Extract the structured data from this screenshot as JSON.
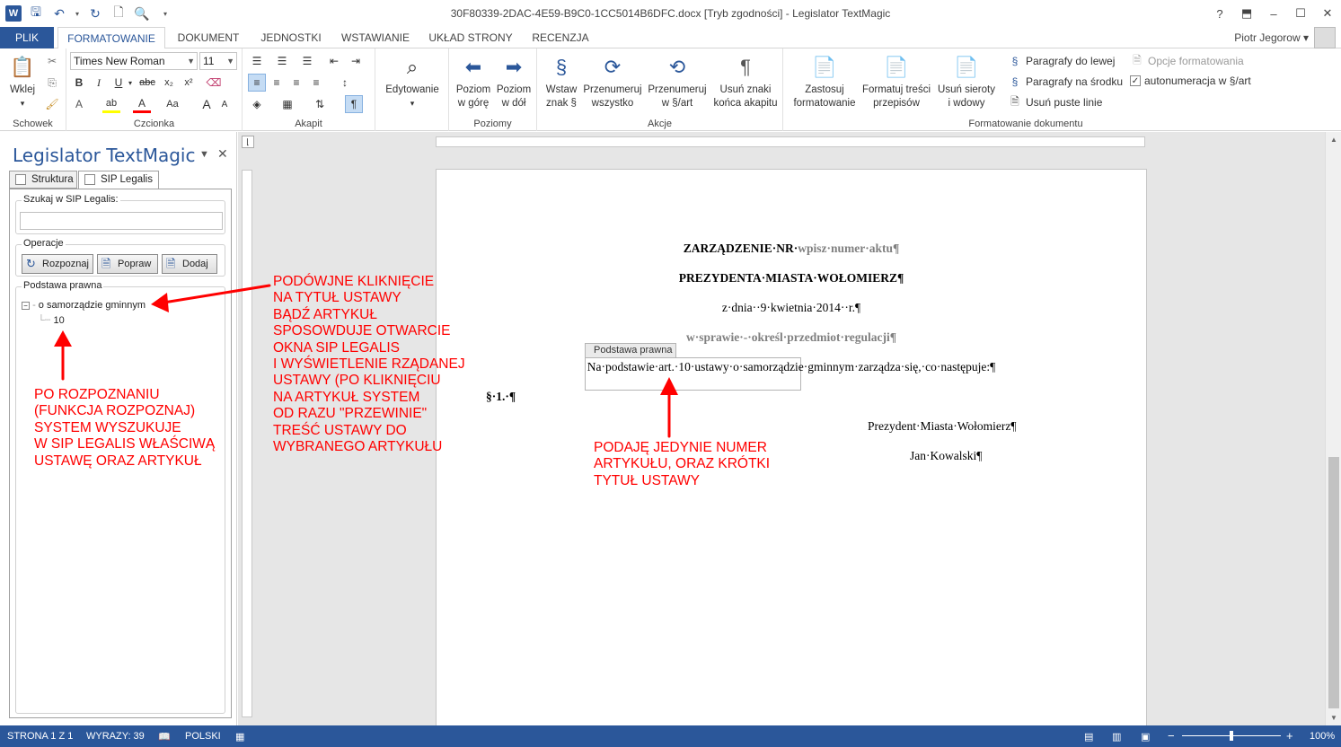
{
  "window": {
    "title": "30F80339-2DAC-4E59-B9C0-1CC5014B6DFC.docx [Tryb zgodności] - Legislator TextMagic",
    "help": "?",
    "minimize": "–",
    "restore": "☐",
    "close": "✕"
  },
  "tabs": [
    "PLIK",
    "FORMATOWANIE",
    "DOKUMENT",
    "JEDNOSTKI",
    "WSTAWIANIE",
    "UKŁAD STRONY",
    "RECENZJA"
  ],
  "user": "Piotr Jegorow",
  "ribbon": {
    "clipboard": {
      "paste": "Wklej",
      "label": "Schowek"
    },
    "font": {
      "name": "Times New Roman",
      "size": "11",
      "label": "Czcionka"
    },
    "paragraph": {
      "label": "Akapit"
    },
    "editing": {
      "label": "Edytowanie"
    },
    "levels": {
      "up_line1": "Poziom",
      "up_line2": "w górę",
      "down_line1": "Poziom",
      "down_line2": "w dół",
      "label": "Poziomy"
    },
    "actions": {
      "insert_line1": "Wstaw",
      "insert_line2": "znak §",
      "renumber_all_line1": "Przenumeruj",
      "renumber_all_line2": "wszystko",
      "renumber_art_line1": "Przenumeruj",
      "renumber_art_line2": "w §/art",
      "remove_line1": "Usuń znaki",
      "remove_line2": "końca akapitu",
      "label": "Akcje"
    },
    "doc_format": {
      "apply_line1": "Zastosuj",
      "apply_line2": "formatowanie",
      "format_line1": "Formatuj treści",
      "format_line2": "przepisów",
      "orphans_line1": "Usuń sieroty",
      "orphans_line2": "i wdowy",
      "para_left": "Paragrafy do lewej",
      "para_center": "Paragrafy na środku",
      "remove_empty": "Usuń puste linie",
      "options": "Opcje formatowania",
      "autonum": "autonumeracja w §/art",
      "label": "Formatowanie dokumentu"
    }
  },
  "pane": {
    "title": "Legislator TextMagic",
    "tab_struct": "Struktura",
    "tab_sip": "SIP Legalis",
    "search_legend": "Szukaj w SIP Legalis:",
    "ops_legend": "Operacje",
    "btn_recognize": "Rozpoznaj",
    "btn_fix": "Popraw",
    "btn_add": "Dodaj",
    "basis_legend": "Podstawa prawna",
    "tree_root": "o samorządzie gminnym",
    "tree_child": "10"
  },
  "annotations": {
    "left": "PO ROZPOZNANIU\n(FUNKCJA ROZPOZNAJ)\nSYSTEM WYSZUKUJE\nW SIP LEGALIS WŁAŚCIWĄ\nUSTAWĘ ORAZ ARTYKUŁ",
    "middle": "PODÓWJNE KLIKNIĘCIE\nNA TYTUŁ USTAWY\nBĄDŹ ARTYKUŁ\nSPOSOWDUJE OTWARCIE\nOKNA SIP LEGALIS\nI WYŚWIETLENIE RZĄDANEJ\nUSTAWY (PO KLIKNIĘCIU\nNA ARTYKUŁ SYSTEM\nOD RAZU \"PRZEWINIE\"\nTREŚĆ USTAWY DO\nWYBRANEGO ARTYKUŁU",
    "right": "PODAJĘ JEDYNIE NUMER\nARTYKUŁU, ORAZ KRÓTKI\nTYTUŁ USTAWY",
    "arrow_color": "#ff0000"
  },
  "document": {
    "line1_prefix": "ZARZĄDZENIE·NR·",
    "line1_placeholder": "wpisz·numer·aktu",
    "line1_mark": "¶",
    "line2": "PREZYDENTA·MIASTA·WOŁOMIERZ¶",
    "line3": "z·dnia··9·kwietnia·2014··r.¶",
    "line4": "w·sprawie·-·określ·przedmiot·regulacji¶",
    "line5_prefix": "Na·podstawie·",
    "line5_control": "art.·10·ustawy·o·samorządzie·gminnym",
    "line5_suffix": "·zarządza·się,·co·następuje:¶",
    "control_tag": "Podstawa prawna",
    "section": "§·1.·¶",
    "signer_title": "Prezydent·Miasta·Wołomierz¶",
    "signer_name": "Jan·Kowalski¶"
  },
  "status": {
    "page": "STRONA 1 Z 1",
    "words": "WYRAZY: 39",
    "lang": "POLSKI",
    "zoom": "100%"
  },
  "colors": {
    "accent": "#2b579a",
    "annotation": "#ff0000"
  }
}
